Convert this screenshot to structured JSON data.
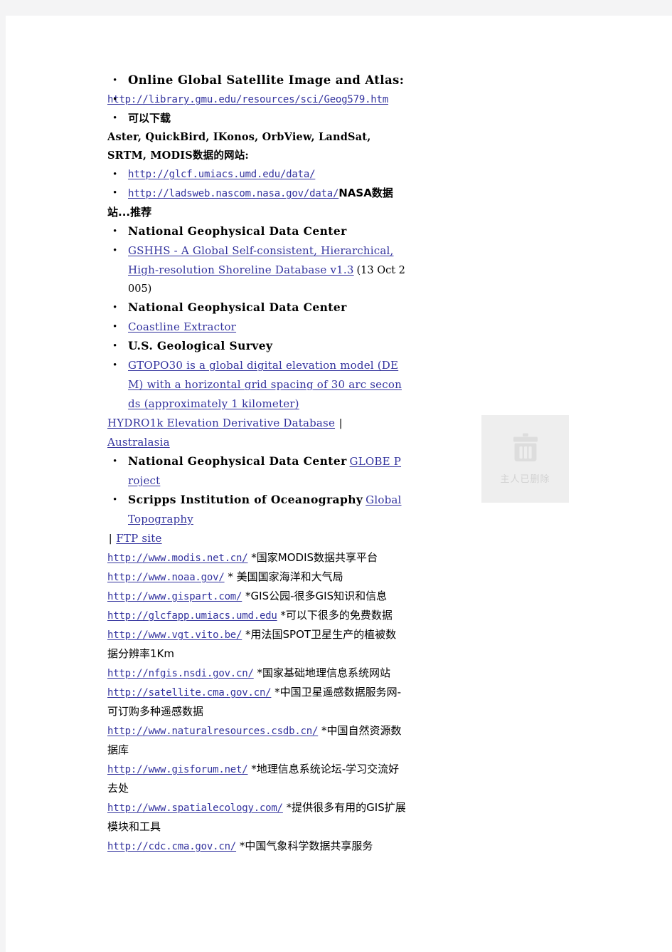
{
  "document": {
    "background_color": "#f4f4f5",
    "page_color": "#ffffff",
    "link_color": "#33339e",
    "text_color": "#000000"
  },
  "blocks": {
    "b1_heading": "Online Global Satellite Image and Atlas:",
    "b2_empty_bullet": "",
    "b3_link_gmu": "http://library.gmu.edu/resources/sci/Geog579.htm",
    "b4_bullet_cn": "可以下载",
    "b5_line_sensors": "Aster, QuickBird, IKonos, OrbView, LandSat,",
    "b6_line_sensors2": "SRTM, MODIS数据的网站:",
    "b7_link_glcf": "http://glcf.umiacs.umd.edu/data/",
    "b8_link_ladsweb": "http://ladsweb.nascom.nasa.gov/data/",
    "b8_suffix_cn": "NASA数据",
    "b9_cn_cont": "站...推荐",
    "b10_ngdc_1": "National Geophysical Data Center",
    "b11_gshhs_link": "GSHHS - A Global Self-consistent, Hierarchical, High-resolution Shoreline Database v1.3",
    "b11_gshhs_date": "(13 Oct 2005)",
    "b12_ngdc_2": "National Geophysical Data Center",
    "b13_coastline_link": "Coastline Extractor",
    "b14_usgs": "U.S. Geological Survey",
    "b15_gtopo_link": "GTOPO30 is a global digital elevation model (DEM) with a horizontal grid spacing of 30 arc seconds (approximately 1 kilometer)",
    "b16_hydro_link": "HYDRO1k Elevation Derivative Database",
    "b16_separator": "|",
    "b17_australasia_link": "Australasia",
    "b18_ngdc_3": "National Geophysical Data Center",
    "b18_globe_link": "GLOBE Project",
    "b19_scripps": "Scripps Institution of Oceanography",
    "b19_global_topo_link": "Global Topography",
    "b19_separator": "|",
    "b19_ftp_link": "FTP site"
  },
  "url_list": [
    {
      "url": "http://www.modis.net.cn/",
      "note": "*国家MODIS数据共享平台"
    },
    {
      "url": "http://www.noaa.gov/",
      "note": "* 美国国家海洋和大气局"
    },
    {
      "url": "http://www.gispart.com/",
      "note": "*GIS公园-很多GIS知识和信息"
    },
    {
      "url": "http://glcfapp.umiacs.umd.edu",
      "note": "*可以下很多的免费数据"
    },
    {
      "url": "http://www.vgt.vito.be/",
      "note": "*用法国SPOT卫星生产的植被数据分辨率1Km"
    },
    {
      "url": "http://nfgis.nsdi.gov.cn/",
      "note": "*国家基础地理信息系统网站"
    },
    {
      "url": "http://satellite.cma.gov.cn/",
      "note": "*中国卫星遥感数据服务网-可订购多种遥感数据"
    },
    {
      "url": "http://www.naturalresources.csdb.cn/",
      "note": "*中国自然资源数据库"
    },
    {
      "url": "http://www.gisforum.net/",
      "note": "*地理信息系统论坛-学习交流好去处"
    },
    {
      "url": "http://www.spatialecology.com/",
      "note": "*提供很多有用的GIS扩展模块和工具"
    },
    {
      "url": "http://cdc.cma.gov.cn/",
      "note": "*中国气象科学数据共享服务"
    }
  ],
  "placeholder": {
    "label": "主人已删除",
    "icon": "trash-icon",
    "background_color": "#eeeeee",
    "text_color": "#d2d2d2"
  }
}
